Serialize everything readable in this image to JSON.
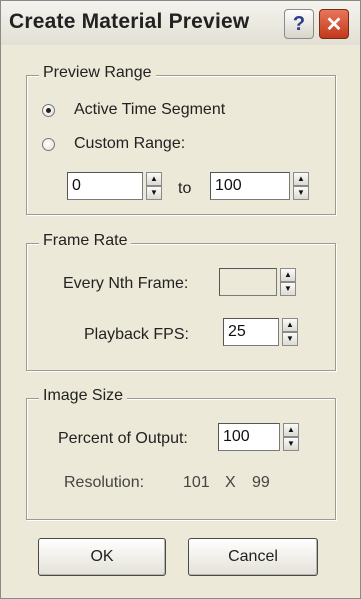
{
  "window": {
    "title": "Create Material Preview",
    "help_glyph": "?",
    "close_glyph": "✕"
  },
  "preview_range": {
    "legend": "Preview Range",
    "active_label": "Active Time Segment",
    "custom_label": "Custom Range:",
    "selected": "active",
    "from_value": "0",
    "to_label": "to",
    "to_value": "100"
  },
  "frame_rate": {
    "legend": "Frame Rate",
    "every_nth_label": "Every Nth Frame:",
    "every_nth_value": "",
    "playback_fps_label": "Playback FPS:",
    "playback_fps_value": "25"
  },
  "image_size": {
    "legend": "Image Size",
    "percent_label": "Percent of Output:",
    "percent_value": "100",
    "resolution_label": "Resolution:",
    "resolution_width": "101",
    "resolution_x": "X",
    "resolution_height": "99"
  },
  "buttons": {
    "ok": "OK",
    "cancel": "Cancel"
  },
  "icons": {
    "spin_up": "▲",
    "spin_down": "▼"
  }
}
